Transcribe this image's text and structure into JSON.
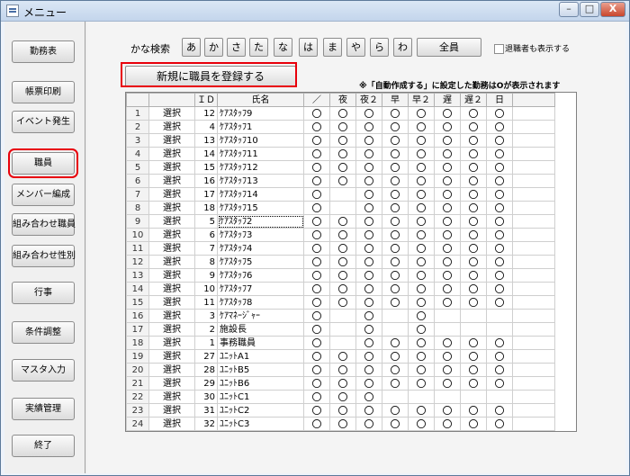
{
  "window": {
    "title": "メニュー",
    "minimize": "–",
    "maximize": "□",
    "close": "X"
  },
  "sidebar": {
    "items": [
      {
        "label": "勤務表",
        "highlighted": false
      },
      {
        "label": "帳票印刷",
        "highlighted": false
      },
      {
        "label": "イベント発生",
        "highlighted": false
      },
      {
        "label": "職員",
        "highlighted": true
      },
      {
        "label": "メンバー編成",
        "highlighted": false
      },
      {
        "label": "組み合わせ職員",
        "highlighted": false
      },
      {
        "label": "組み合わせ性別",
        "highlighted": false
      },
      {
        "label": "行事",
        "highlighted": false
      },
      {
        "label": "条件調整",
        "highlighted": false
      },
      {
        "label": "マスタ入力",
        "highlighted": false
      },
      {
        "label": "実績管理",
        "highlighted": false
      },
      {
        "label": "終了",
        "highlighted": false
      }
    ]
  },
  "kana_search": {
    "label": "かな検索",
    "buttons": [
      "あ",
      "か",
      "さ",
      "た",
      "な",
      "は",
      "ま",
      "や",
      "ら",
      "わ"
    ],
    "all_label": "全員",
    "retired_label": "退職者も表示する"
  },
  "new_button": {
    "label": "新規に職員を登録する"
  },
  "note": "※「自動作成する」に設定した勤務はOが表示されます",
  "table": {
    "headers": [
      "",
      "",
      "ＩＤ",
      "氏名",
      "／",
      "夜",
      "夜２",
      "早",
      "早２",
      "遅",
      "遅２",
      "日"
    ],
    "rows": [
      {
        "no": "1",
        "sel": "選択",
        "id": "12",
        "name": "ｹｱｽﾀｯﾌ9",
        "marks": [
          "〇",
          "〇",
          "〇",
          "〇",
          "〇",
          "〇",
          "〇",
          "〇"
        ]
      },
      {
        "no": "2",
        "sel": "選択",
        "id": "4",
        "name": "ｹｱｽﾀｯﾌ1",
        "marks": [
          "〇",
          "〇",
          "〇",
          "〇",
          "〇",
          "〇",
          "〇",
          "〇"
        ]
      },
      {
        "no": "3",
        "sel": "選択",
        "id": "13",
        "name": "ｹｱｽﾀｯﾌ10",
        "marks": [
          "〇",
          "〇",
          "〇",
          "〇",
          "〇",
          "〇",
          "〇",
          "〇"
        ]
      },
      {
        "no": "4",
        "sel": "選択",
        "id": "14",
        "name": "ｹｱｽﾀｯﾌ11",
        "marks": [
          "〇",
          "〇",
          "〇",
          "〇",
          "〇",
          "〇",
          "〇",
          "〇"
        ]
      },
      {
        "no": "5",
        "sel": "選択",
        "id": "15",
        "name": "ｹｱｽﾀｯﾌ12",
        "marks": [
          "〇",
          "〇",
          "〇",
          "〇",
          "〇",
          "〇",
          "〇",
          "〇"
        ]
      },
      {
        "no": "6",
        "sel": "選択",
        "id": "16",
        "name": "ｹｱｽﾀｯﾌ13",
        "marks": [
          "〇",
          "〇",
          "〇",
          "〇",
          "〇",
          "〇",
          "〇",
          "〇"
        ]
      },
      {
        "no": "7",
        "sel": "選択",
        "id": "17",
        "name": "ｹｱｽﾀｯﾌ14",
        "marks": [
          "〇",
          "",
          "〇",
          "〇",
          "〇",
          "〇",
          "〇",
          "〇"
        ]
      },
      {
        "no": "8",
        "sel": "選択",
        "id": "18",
        "name": "ｹｱｽﾀｯﾌ15",
        "marks": [
          "〇",
          "",
          "〇",
          "〇",
          "〇",
          "〇",
          "〇",
          "〇"
        ]
      },
      {
        "no": "9",
        "sel": "選択",
        "id": "5",
        "name": "ｹｱｽﾀｯﾌ2",
        "marks": [
          "〇",
          "〇",
          "〇",
          "〇",
          "〇",
          "〇",
          "〇",
          "〇"
        ]
      },
      {
        "no": "10",
        "sel": "選択",
        "id": "6",
        "name": "ｹｱｽﾀｯﾌ3",
        "marks": [
          "〇",
          "〇",
          "〇",
          "〇",
          "〇",
          "〇",
          "〇",
          "〇"
        ]
      },
      {
        "no": "11",
        "sel": "選択",
        "id": "7",
        "name": "ｹｱｽﾀｯﾌ4",
        "marks": [
          "〇",
          "〇",
          "〇",
          "〇",
          "〇",
          "〇",
          "〇",
          "〇"
        ]
      },
      {
        "no": "12",
        "sel": "選択",
        "id": "8",
        "name": "ｹｱｽﾀｯﾌ5",
        "marks": [
          "〇",
          "〇",
          "〇",
          "〇",
          "〇",
          "〇",
          "〇",
          "〇"
        ]
      },
      {
        "no": "13",
        "sel": "選択",
        "id": "9",
        "name": "ｹｱｽﾀｯﾌ6",
        "marks": [
          "〇",
          "〇",
          "〇",
          "〇",
          "〇",
          "〇",
          "〇",
          "〇"
        ]
      },
      {
        "no": "14",
        "sel": "選択",
        "id": "10",
        "name": "ｹｱｽﾀｯﾌ7",
        "marks": [
          "〇",
          "〇",
          "〇",
          "〇",
          "〇",
          "〇",
          "〇",
          "〇"
        ]
      },
      {
        "no": "15",
        "sel": "選択",
        "id": "11",
        "name": "ｹｱｽﾀｯﾌ8",
        "marks": [
          "〇",
          "〇",
          "〇",
          "〇",
          "〇",
          "〇",
          "〇",
          "〇"
        ]
      },
      {
        "no": "16",
        "sel": "選択",
        "id": "3",
        "name": "ｹｱﾏﾈｰｼﾞｬｰ",
        "marks": [
          "〇",
          "",
          "〇",
          "",
          "〇",
          "",
          "",
          ""
        ]
      },
      {
        "no": "17",
        "sel": "選択",
        "id": "2",
        "name": "施設長",
        "marks": [
          "〇",
          "",
          "〇",
          "",
          "〇",
          "",
          "",
          ""
        ]
      },
      {
        "no": "18",
        "sel": "選択",
        "id": "1",
        "name": "事務職員",
        "marks": [
          "〇",
          "",
          "〇",
          "〇",
          "〇",
          "〇",
          "〇",
          "〇"
        ]
      },
      {
        "no": "19",
        "sel": "選択",
        "id": "27",
        "name": "ﾕﾆｯﾄA1",
        "marks": [
          "〇",
          "〇",
          "〇",
          "〇",
          "〇",
          "〇",
          "〇",
          "〇"
        ]
      },
      {
        "no": "20",
        "sel": "選択",
        "id": "28",
        "name": "ﾕﾆｯﾄB5",
        "marks": [
          "〇",
          "〇",
          "〇",
          "〇",
          "〇",
          "〇",
          "〇",
          "〇"
        ]
      },
      {
        "no": "21",
        "sel": "選択",
        "id": "29",
        "name": "ﾕﾆｯﾄB6",
        "marks": [
          "〇",
          "〇",
          "〇",
          "〇",
          "〇",
          "〇",
          "〇",
          "〇"
        ]
      },
      {
        "no": "22",
        "sel": "選択",
        "id": "30",
        "name": "ﾕﾆｯﾄC1",
        "marks": [
          "〇",
          "〇",
          "〇",
          "",
          "",
          "",
          "",
          ""
        ]
      },
      {
        "no": "23",
        "sel": "選択",
        "id": "31",
        "name": "ﾕﾆｯﾄC2",
        "marks": [
          "〇",
          "〇",
          "〇",
          "〇",
          "〇",
          "〇",
          "〇",
          "〇"
        ]
      },
      {
        "no": "24",
        "sel": "選択",
        "id": "32",
        "name": "ﾕﾆｯﾄC3",
        "marks": [
          "〇",
          "〇",
          "〇",
          "〇",
          "〇",
          "〇",
          "〇",
          "〇"
        ]
      }
    ]
  },
  "scrollbar": {
    "up": "▲",
    "down": "▼"
  },
  "colors": {
    "highlight": "#e8000b"
  }
}
